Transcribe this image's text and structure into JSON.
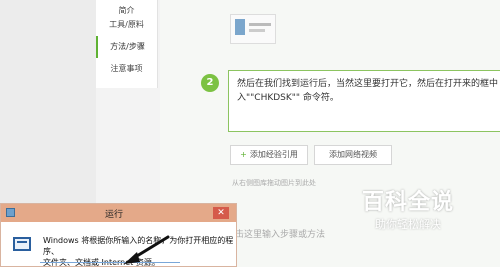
{
  "sidebar": {
    "items": [
      {
        "label": "简介"
      },
      {
        "label": "工具/原料"
      },
      {
        "label": "方法/步骤"
      },
      {
        "label": "注意事项"
      }
    ]
  },
  "step": {
    "number": "2",
    "line1": "然后在我们找到运行后，当然这里要打开它，然后在打开来的框中",
    "line2": "入\"\"CHKDSK\"\" 命令符。"
  },
  "buttons": {
    "add_experience": "添加经验引用",
    "add_video": "添加网络视频"
  },
  "image_hint": "从右侧图库拖动图片到此处",
  "placeholder": "击这里输入步骤或方法",
  "logo": {
    "main": "百科全说",
    "sub": "助你轻松解决"
  },
  "dialog": {
    "title": "运行",
    "close": "✕",
    "text_line1": "Windows 将根据你所输入的名称，为你打开相应的程序、",
    "text_line2": "文件夹、文档或 Internet 资源。"
  },
  "colors": {
    "accent_green": "#7cc243",
    "dialog_titlebar": "#e4a989",
    "arrow": "#111111"
  }
}
